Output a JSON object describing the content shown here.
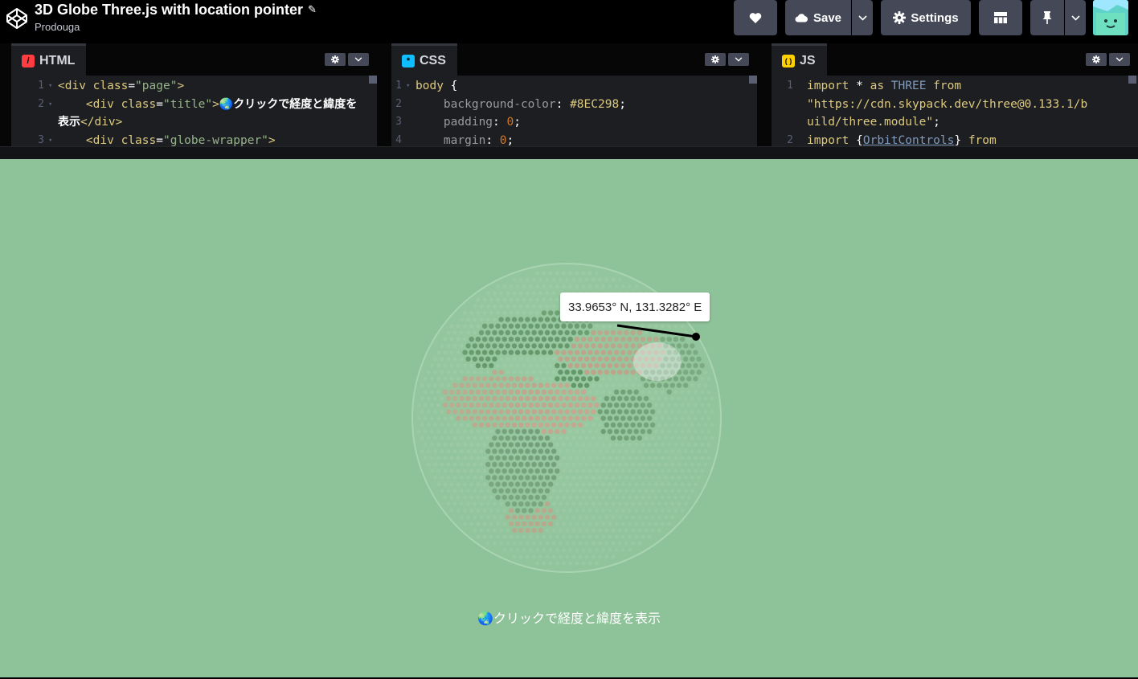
{
  "header": {
    "title": "3D Globe Three.js with location pointer",
    "author": "Prodouga",
    "save_label": "Save",
    "settings_label": "Settings"
  },
  "editors": {
    "html": {
      "tab": "HTML",
      "color": "#ff3c41",
      "lines": [
        {
          "n": "1",
          "open": "<div ",
          "attr": "class",
          "eq": "=",
          "val": "\"page\"",
          "close": ">"
        },
        {
          "n": "2",
          "indent": "    ",
          "open": "<div ",
          "attr": "class",
          "eq": "=",
          "val": "\"title\"",
          "close": ">",
          "text": "🌏クリックで経度と緯度を"
        },
        {
          "n": "",
          "text": "表示",
          "endtag": "</div>"
        },
        {
          "n": "3",
          "indent": "    ",
          "open": "<div ",
          "attr": "class",
          "eq": "=",
          "val": "\"globe-wrapper\"",
          "close": ">"
        }
      ]
    },
    "css": {
      "tab": "CSS",
      "color": "#0ebeff",
      "lines": [
        {
          "n": "1",
          "selector": "body",
          "brace": " {"
        },
        {
          "n": "2",
          "prop": "background-color",
          "value": "#8EC298",
          "semi": ";"
        },
        {
          "n": "3",
          "prop": "padding",
          "value": "0",
          "semi": ";"
        },
        {
          "n": "4",
          "prop": "margin",
          "value": "0",
          "semi": ";"
        }
      ]
    },
    "js": {
      "tab": "JS",
      "color": "#fcd000",
      "lines": [
        {
          "n": "1",
          "kw1": "import",
          "mid": " * ",
          "kw2": "as",
          "ident": " THREE ",
          "kw3": "from"
        },
        {
          "n": "",
          "str": "\"https://cdn.skypack.dev/three@0.133.1/b"
        },
        {
          "n": "",
          "str": "uild/three.module\"",
          "semi": ";"
        },
        {
          "n": "2",
          "kw1": "import",
          "mid": " {",
          "ident": "OrbitControls",
          "mid2": "} ",
          "kw3": "from"
        }
      ]
    }
  },
  "result": {
    "tooltip": "33.9653° N, 131.3282° E",
    "caption": "🌏クリックで経度と緯度を表示",
    "background": "#8ec298"
  }
}
